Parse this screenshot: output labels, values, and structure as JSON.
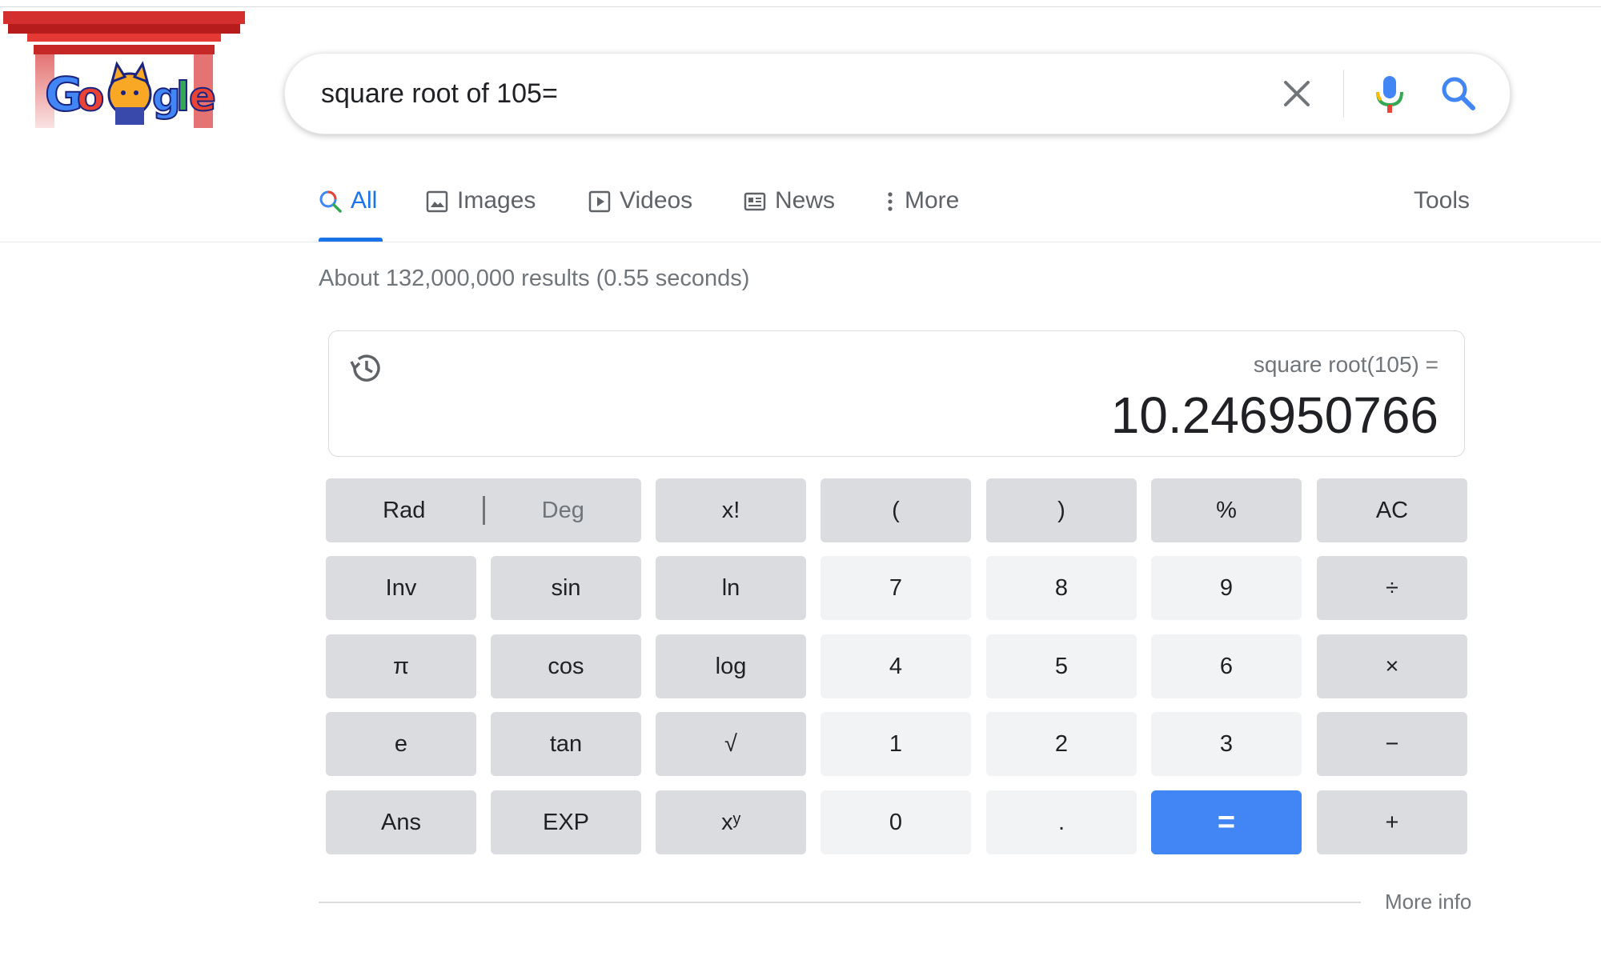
{
  "search": {
    "query": "square root of 105="
  },
  "tabs": [
    {
      "label": "All",
      "icon": "search-icon",
      "active": true
    },
    {
      "label": "Images",
      "icon": "image-icon"
    },
    {
      "label": "Videos",
      "icon": "play-icon"
    },
    {
      "label": "News",
      "icon": "news-icon"
    },
    {
      "label": "More",
      "icon": "more-vert-icon"
    },
    {
      "label": "Tools"
    }
  ],
  "result_stats": "About 132,000,000 results (0.55 seconds)",
  "calculator": {
    "expression": "square root(105) =",
    "result": "10.246950766",
    "rad_label": "Rad",
    "deg_label": "Deg",
    "keys": [
      "x!",
      "(",
      ")",
      "%",
      "AC",
      "Inv",
      "sin",
      "ln",
      "7",
      "8",
      "9",
      "÷",
      "π",
      "cos",
      "log",
      "4",
      "5",
      "6",
      "×",
      "e",
      "tan",
      "√",
      "1",
      "2",
      "3",
      "−",
      "Ans",
      "EXP",
      "xʸ",
      "0",
      ".",
      "=",
      "+"
    ]
  },
  "more_info": "More info",
  "colors": {
    "accent": "#1a73e8",
    "equals_key": "#4285f4",
    "op_key": "#dadce0",
    "num_key": "#f1f3f4"
  }
}
